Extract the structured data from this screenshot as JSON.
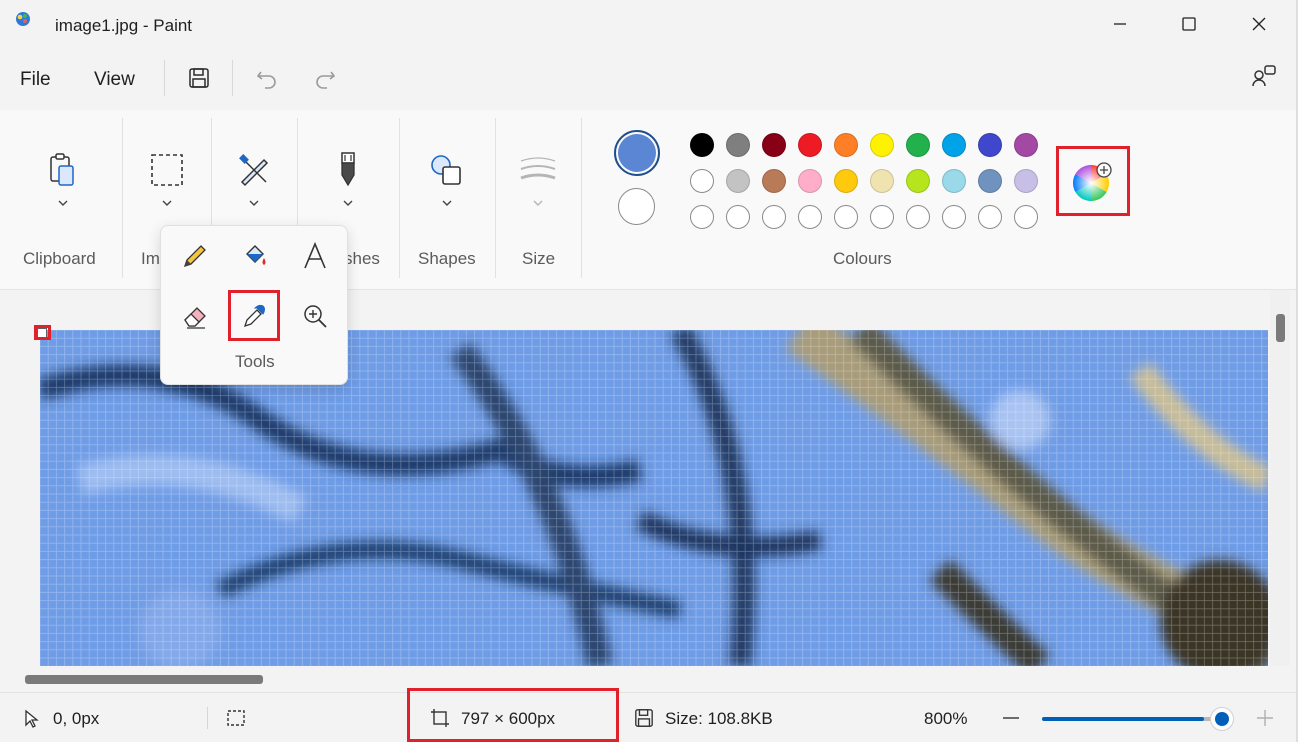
{
  "window": {
    "title": "image1.jpg - Paint"
  },
  "menu": {
    "file": "File",
    "view": "View"
  },
  "ribbon": {
    "groups": {
      "clipboard": "Clipboard",
      "image": "Im",
      "brushes": "shes",
      "shapes": "Shapes",
      "size": "Size",
      "colours": "Colours"
    }
  },
  "tools_popup": {
    "label": "Tools"
  },
  "colors": {
    "primary": "#5a86d4",
    "secondary": "#ffffff",
    "palette_row1": [
      "#000000",
      "#7f7f7f",
      "#880015",
      "#ed1c24",
      "#ff7f27",
      "#fff200",
      "#22b14c",
      "#00a2e8",
      "#3f48cc",
      "#a349a4"
    ],
    "palette_row2": [
      "#ffffff",
      "#c3c3c3",
      "#b97a57",
      "#ffaec9",
      "#ffc90e",
      "#efe4b0",
      "#b5e61d",
      "#99d9ea",
      "#7092be",
      "#c8bfe7"
    ],
    "palette_row3": [
      "#ffffff",
      "#ffffff",
      "#ffffff",
      "#ffffff",
      "#ffffff",
      "#ffffff",
      "#ffffff",
      "#ffffff",
      "#ffffff",
      "#ffffff"
    ],
    "highlight": "#e0202a",
    "accent": "#005fb8"
  },
  "status": {
    "cursor_pos": "0, 0px",
    "canvas_size": "797 × 600px",
    "file_size": "Size: 108.8KB",
    "zoom": "800%",
    "zoom_fraction": 0.9
  },
  "icons": {
    "app": "paint-app-icon",
    "save": "save-icon",
    "undo": "undo-icon",
    "redo": "redo-icon",
    "copilot": "collab-icon",
    "clipboard": "clipboard-icon",
    "select": "select-icon",
    "tools": "tools-icon",
    "brushes": "brush-icon",
    "shapes": "shapes-icon",
    "size": "size-icon",
    "pencil": "pencil-icon",
    "fill": "fill-bucket-icon",
    "text": "text-icon",
    "eraser": "eraser-icon",
    "picker": "color-picker-icon",
    "magnifier": "magnifier-icon",
    "edit_colors": "edit-colors-icon"
  }
}
